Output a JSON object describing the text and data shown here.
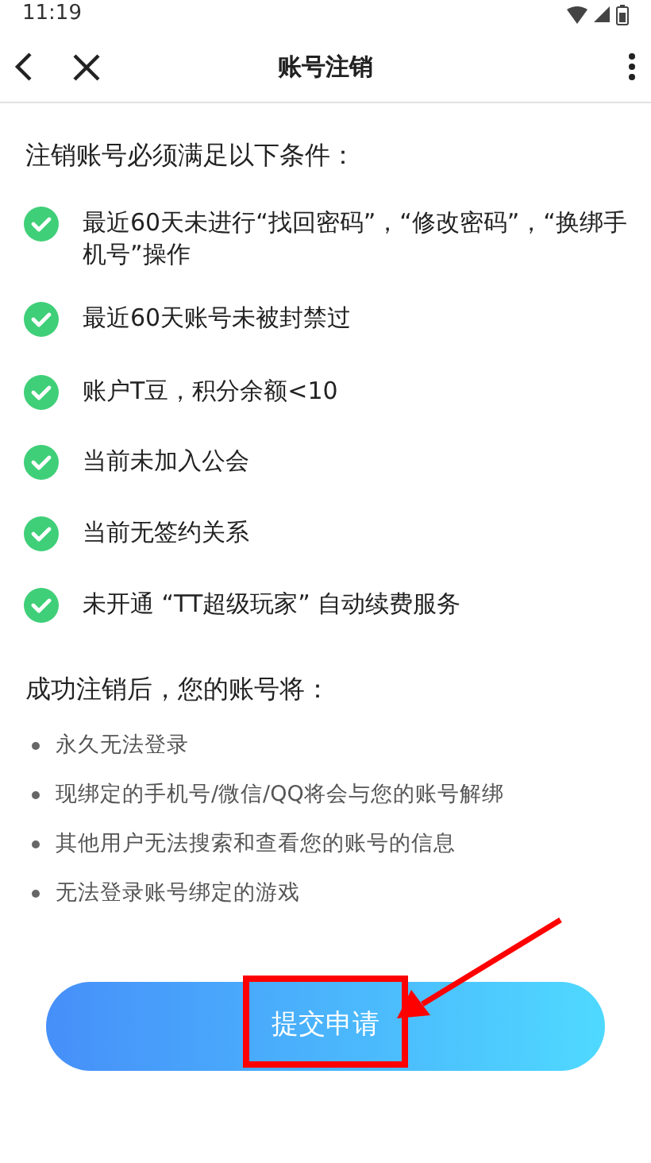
{
  "status_bar": {
    "time": "11:19"
  },
  "header": {
    "title": "账号注销"
  },
  "conditions": {
    "heading": "注销账号必须满足以下条件：",
    "items": [
      {
        "text": "最近60天未进行“找回密码”，“修改密码”，“换绑手机号”操作",
        "checked": true
      },
      {
        "text": "最近60天账号未被封禁过",
        "checked": true
      },
      {
        "text": "账户T豆，积分余额<10",
        "checked": true
      },
      {
        "text": "当前未加入公会",
        "checked": true
      },
      {
        "text": "当前无签约关系",
        "checked": true
      },
      {
        "text": "未开通 “TT超级玩家” 自动续费服务",
        "checked": true
      }
    ]
  },
  "consequences": {
    "heading": "成功注销后，您的账号将：",
    "items": [
      "永久无法登录",
      "现绑定的手机号/微信/QQ将会与您的账号解绑",
      "其他用户无法搜索和查看您的账号的信息",
      "无法登录账号绑定的游戏"
    ]
  },
  "submit_button": {
    "label": "提交申请",
    "highlighted": true
  }
}
